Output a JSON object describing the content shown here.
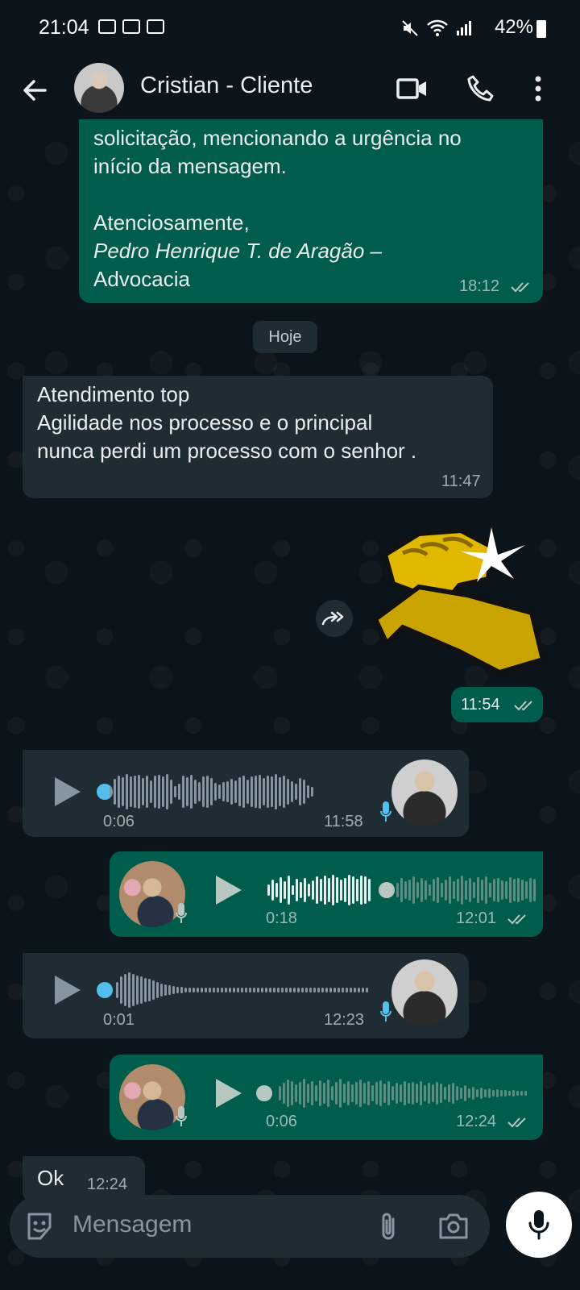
{
  "status_bar": {
    "time": "21:04",
    "battery": "42%"
  },
  "header": {
    "contact_name": "Cristian - Cliente"
  },
  "messages": {
    "m1": {
      "line1": "solicitação, mencionando a urgência no",
      "line2": "início da mensagem.",
      "line3": "Atenciosamente,",
      "line4": "Pedro Henrique T. de Aragão –",
      "line5": "Advocacia",
      "time": "18:12"
    },
    "date_label": "Hoje",
    "m2": {
      "line1": "Atendimento top",
      "line2": "Agilidade nos processo e o principal",
      "line3": "nunca perdi um processo com o senhor .",
      "time": "11:47"
    },
    "m3_time": "11:54",
    "v1": {
      "duration": "0:06",
      "time": "11:58"
    },
    "v2": {
      "duration": "0:18",
      "time": "12:01"
    },
    "v3": {
      "duration": "0:01",
      "time": "12:23"
    },
    "v4": {
      "duration": "0:06",
      "time": "12:24"
    },
    "m4": {
      "text": "Ok",
      "time": "12:24"
    }
  },
  "input": {
    "placeholder": "Mensagem"
  },
  "icons": [
    "back-arrow-icon",
    "video-call-icon",
    "phone-icon",
    "more-icon",
    "forward-icon",
    "play-icon",
    "mic-icon",
    "sticker-icon",
    "attach-icon",
    "camera-icon",
    "read-ticks-icon"
  ],
  "colors": {
    "background": "#0b141a",
    "outgoing": "#005c4b",
    "incoming": "#202c33",
    "accent_blue": "#53bdeb"
  }
}
